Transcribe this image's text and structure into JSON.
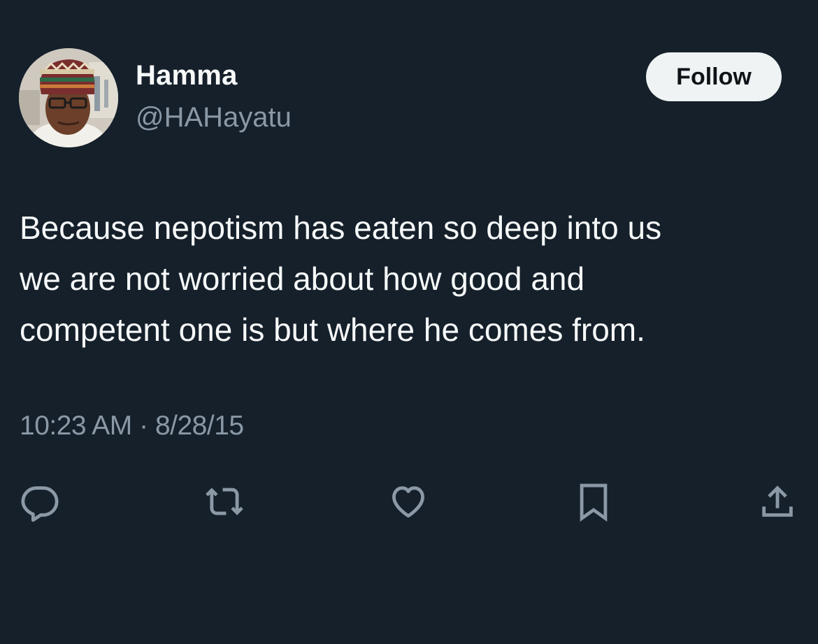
{
  "author": {
    "display_name": "Hamma",
    "handle": "@HAHayatu",
    "avatar": "profile-photo"
  },
  "follow_button": {
    "label": "Follow"
  },
  "tweet": {
    "text_lines": [
      "Because nepotism has eaten so deep into us",
      "we are not worried about how good and",
      "competent one is but where he comes from."
    ]
  },
  "meta": {
    "time": "10:23 AM",
    "separator": "·",
    "date": "8/28/15"
  },
  "actions": [
    {
      "name": "reply",
      "icon": "reply-icon"
    },
    {
      "name": "retweet",
      "icon": "retweet-icon"
    },
    {
      "name": "like",
      "icon": "heart-icon"
    },
    {
      "name": "bookmark",
      "icon": "bookmark-icon"
    },
    {
      "name": "share",
      "icon": "share-icon"
    }
  ],
  "colors": {
    "background": "#15202b",
    "primary_text": "#f7f9f9",
    "secondary_text": "#8b98a5",
    "follow_button_bg": "#eff3f4",
    "follow_button_text": "#0f1419"
  }
}
